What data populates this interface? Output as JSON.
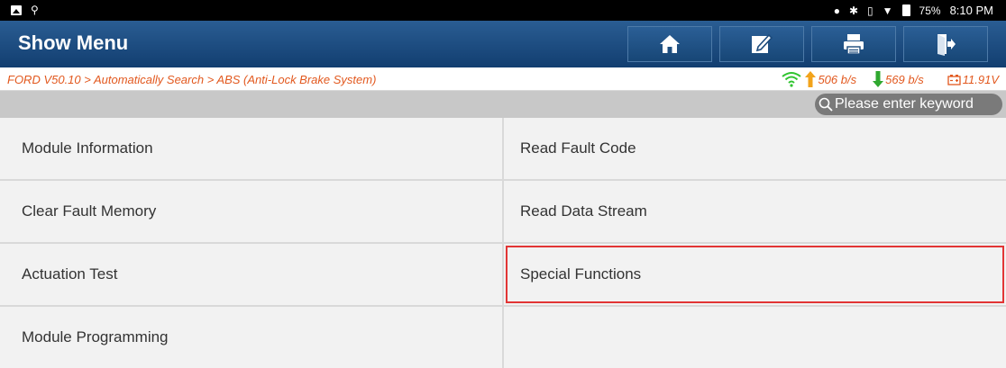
{
  "status_bar": {
    "battery": "75%",
    "time": "8:10 PM"
  },
  "header": {
    "title": "Show Menu",
    "buttons": [
      "home-icon",
      "edit-icon",
      "print-icon",
      "exit-icon"
    ]
  },
  "breadcrumb": "FORD V50.10 > Automatically Search > ABS (Anti-Lock Brake System)",
  "stats": {
    "upload": "506 b/s",
    "download": "569 b/s",
    "voltage": "11.91V"
  },
  "search": {
    "placeholder": "Please enter keyword"
  },
  "menu": {
    "items": [
      "Module Information",
      "Read Fault Code",
      "Clear Fault Memory",
      "Read Data Stream",
      "Actuation Test",
      "Special Functions",
      "Module Programming",
      ""
    ],
    "highlighted": "Special Functions"
  },
  "colors": {
    "header": "#1d4b7e",
    "breadcrumb_text": "#e2581e",
    "wifi": "#2fc42f",
    "upload_arrow": "#f2a31b",
    "download_arrow": "#2fa82f",
    "highlight_border": "#e23535"
  }
}
